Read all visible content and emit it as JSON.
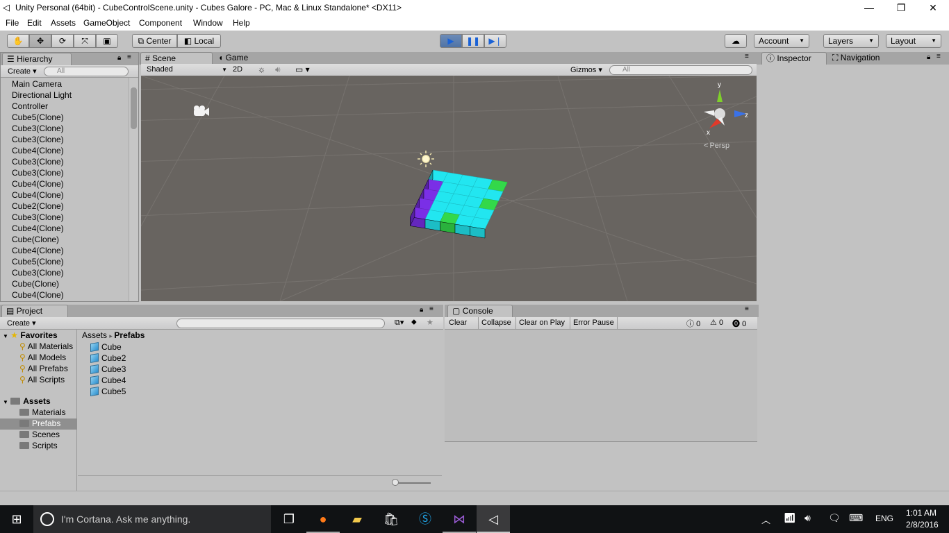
{
  "window": {
    "title": "Unity Personal (64bit) - CubeControlScene.unity - Cubes Galore - PC, Mac & Linux Standalone* <DX11>",
    "minimize": "—",
    "restore": "❐",
    "close": "✕"
  },
  "menu": [
    "File",
    "Edit",
    "Assets",
    "GameObject",
    "Component",
    "Window",
    "Help"
  ],
  "toolbar": {
    "pivot": "Center",
    "space": "Local",
    "account": "Account",
    "layers": "Layers",
    "layout": "Layout"
  },
  "hierarchy": {
    "tab": "Hierarchy",
    "create": "Create",
    "search_placeholder": "All",
    "items": [
      "Main Camera",
      "Directional Light",
      "Controller",
      "Cube5(Clone)",
      "Cube3(Clone)",
      "Cube3(Clone)",
      "Cube4(Clone)",
      "Cube3(Clone)",
      "Cube3(Clone)",
      "Cube4(Clone)",
      "Cube4(Clone)",
      "Cube2(Clone)",
      "Cube3(Clone)",
      "Cube4(Clone)",
      "Cube(Clone)",
      "Cube4(Clone)",
      "Cube5(Clone)",
      "Cube3(Clone)",
      "Cube(Clone)",
      "Cube4(Clone)"
    ]
  },
  "scene": {
    "tab_scene": "Scene",
    "tab_game": "Game",
    "shading": "Shaded",
    "mode_2d": "2D",
    "gizmos": "Gizmos",
    "search_placeholder": "All",
    "persp": "Persp",
    "axis_y": "y",
    "axis_z": "z",
    "axis_x": "x",
    "colors": {
      "cyan": "#22e6f0",
      "green": "#33d84a",
      "purple": "#7a2fe6",
      "background": "#686460"
    }
  },
  "inspector": {
    "tab": "Inspector",
    "tab_nav": "Navigation"
  },
  "project": {
    "tab": "Project",
    "create": "Create",
    "favorites_label": "Favorites",
    "favorites": [
      "All Materials",
      "All Models",
      "All Prefabs",
      "All Scripts"
    ],
    "assets_label": "Assets",
    "folders": [
      "Materials",
      "Prefabs",
      "Scenes",
      "Scripts"
    ],
    "breadcrumb_root": "Assets",
    "breadcrumb_current": "Prefabs",
    "prefabs": [
      "Cube",
      "Cube2",
      "Cube3",
      "Cube4",
      "Cube5"
    ]
  },
  "console": {
    "tab": "Console",
    "clear": "Clear",
    "collapse": "Collapse",
    "clear_on_play": "Clear on Play",
    "error_pause": "Error Pause",
    "info_count": "0",
    "warn_count": "0",
    "error_count": "0"
  },
  "taskbar": {
    "cortana": "I'm Cortana. Ask me anything.",
    "lang": "ENG",
    "time": "1:01 AM",
    "date": "2/8/2016"
  }
}
